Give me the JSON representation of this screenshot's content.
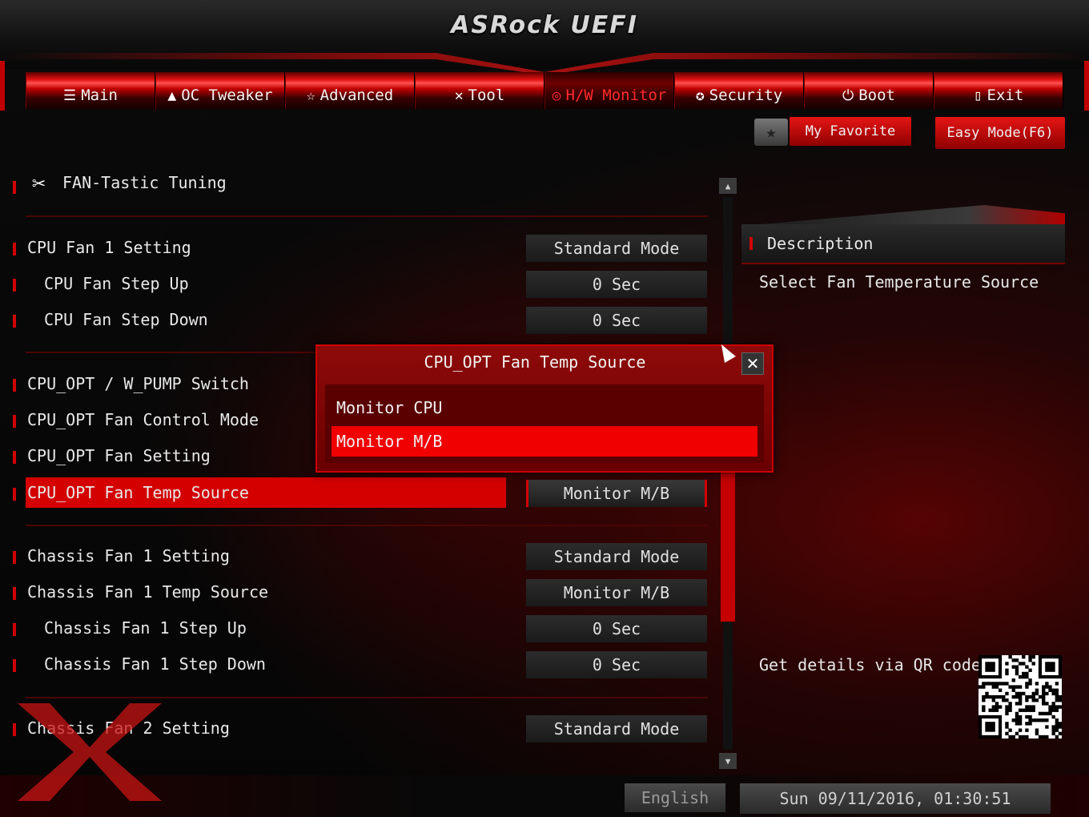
{
  "app": {
    "title": "ASRock UEFI"
  },
  "tabs": [
    {
      "label": "Main",
      "icon": "list-icon"
    },
    {
      "label": "OC Tweaker",
      "icon": "rocket-icon"
    },
    {
      "label": "Advanced",
      "icon": "star-icon"
    },
    {
      "label": "Tool",
      "icon": "tools-icon"
    },
    {
      "label": "H/W Monitor",
      "icon": "monitor-gauge-icon"
    },
    {
      "label": "Security",
      "icon": "shield-icon"
    },
    {
      "label": "Boot",
      "icon": "power-icon"
    },
    {
      "label": "Exit",
      "icon": "exit-icon"
    }
  ],
  "active_tab": "H/W Monitor",
  "toolbar": {
    "my_favorite": "My Favorite",
    "easy_mode": "Easy Mode(F6)"
  },
  "section": {
    "title": "FAN-Tastic Tuning"
  },
  "settings": [
    {
      "label": "CPU Fan 1 Setting",
      "value": "Standard Mode"
    },
    {
      "label": "CPU Fan Step Up",
      "value": "0 Sec"
    },
    {
      "label": "CPU Fan Step Down",
      "value": "0 Sec"
    },
    {
      "label": "CPU_OPT / W_PUMP Switch"
    },
    {
      "label": "CPU_OPT Fan Control Mode"
    },
    {
      "label": "CPU_OPT Fan Setting"
    },
    {
      "label": "CPU_OPT Fan Temp Source",
      "value": "Monitor M/B"
    },
    {
      "label": "Chassis Fan 1 Setting",
      "value": "Standard Mode"
    },
    {
      "label": "Chassis Fan 1 Temp Source",
      "value": "Monitor M/B"
    },
    {
      "label": "Chassis Fan 1 Step Up",
      "value": "0 Sec"
    },
    {
      "label": "Chassis Fan 1 Step Down",
      "value": "0 Sec"
    },
    {
      "label": "Chassis Fan 2 Setting",
      "value": "Standard Mode"
    }
  ],
  "description": {
    "title": "Description",
    "text": "Select Fan Temperature Source",
    "qr_label": "Get details via QR code"
  },
  "popup": {
    "title": "CPU_OPT Fan Temp Source",
    "options": [
      "Monitor CPU",
      "Monitor M/B"
    ],
    "selected": "Monitor M/B"
  },
  "footer": {
    "language": "English",
    "datetime": "Sun 09/11/2016, 01:30:51"
  },
  "colors": {
    "accent": "#d40000",
    "background": "#050505",
    "text": "#e8e8e8"
  }
}
